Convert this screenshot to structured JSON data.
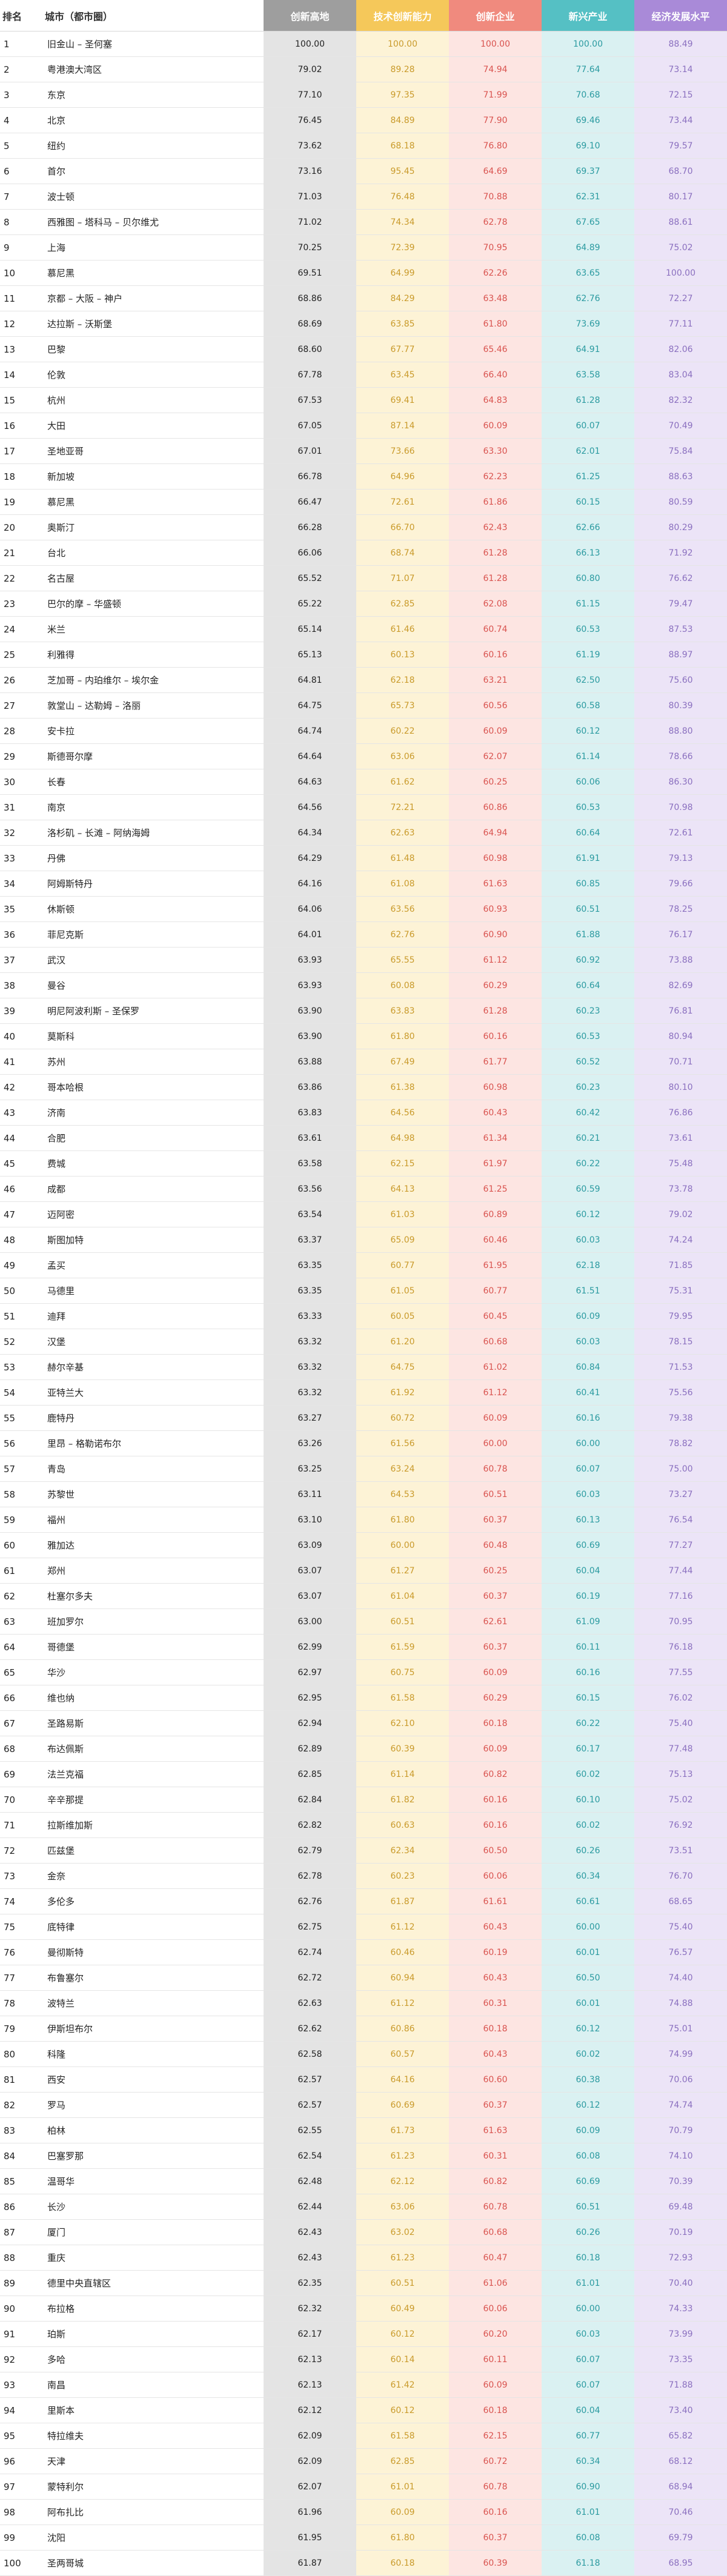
{
  "header": {
    "rank": "排名",
    "city": "城市（都市圈）",
    "metrics": [
      {
        "label": "创新高地",
        "bg": "#9e9e9e",
        "cell_bg": "#e4e4e4",
        "text": "#222222"
      },
      {
        "label": "技术创新能力",
        "bg": "#f5c85a",
        "cell_bg": "#fdf3d6",
        "text": "#c99a2a"
      },
      {
        "label": "创新企业",
        "bg": "#f08a7e",
        "cell_bg": "#fde5e2",
        "text": "#d9534f"
      },
      {
        "label": "新兴产业",
        "bg": "#55c0c4",
        "cell_bg": "#daf1f2",
        "text": "#2a9aa0"
      },
      {
        "label": "经济发展水平",
        "bg": "#a98ad8",
        "cell_bg": "#ece4f7",
        "text": "#8a6fbf"
      }
    ]
  },
  "rows": [
    {
      "rank": "1",
      "city": "旧金山 – 圣何塞",
      "values": [
        "100.00",
        "100.00",
        "100.00",
        "100.00",
        "88.49"
      ]
    },
    {
      "rank": "2",
      "city": "粤港澳大湾区",
      "values": [
        "79.02",
        "89.28",
        "74.94",
        "77.64",
        "73.14"
      ]
    },
    {
      "rank": "3",
      "city": "东京",
      "values": [
        "77.10",
        "97.35",
        "71.99",
        "70.68",
        "72.15"
      ]
    },
    {
      "rank": "4",
      "city": "北京",
      "values": [
        "76.45",
        "84.89",
        "77.90",
        "69.46",
        "73.44"
      ]
    },
    {
      "rank": "5",
      "city": "纽约",
      "values": [
        "73.62",
        "68.18",
        "76.80",
        "69.10",
        "79.57"
      ]
    },
    {
      "rank": "6",
      "city": "首尔",
      "values": [
        "73.16",
        "95.45",
        "64.69",
        "69.37",
        "68.70"
      ]
    },
    {
      "rank": "7",
      "city": "波士顿",
      "values": [
        "71.03",
        "76.48",
        "70.88",
        "62.31",
        "80.17"
      ]
    },
    {
      "rank": "8",
      "city": "西雅图 – 塔科马 – 贝尔维尤",
      "values": [
        "71.02",
        "74.34",
        "62.78",
        "67.65",
        "88.61"
      ]
    },
    {
      "rank": "9",
      "city": "上海",
      "values": [
        "70.25",
        "72.39",
        "70.95",
        "64.89",
        "75.02"
      ]
    },
    {
      "rank": "10",
      "city": "慕尼黑",
      "values": [
        "69.51",
        "64.99",
        "62.26",
        "63.65",
        "100.00"
      ]
    },
    {
      "rank": "11",
      "city": "京都 – 大阪 – 神户",
      "values": [
        "68.86",
        "84.29",
        "63.48",
        "62.76",
        "72.27"
      ]
    },
    {
      "rank": "12",
      "city": "达拉斯 – 沃斯堡",
      "values": [
        "68.69",
        "63.85",
        "61.80",
        "73.69",
        "77.11"
      ]
    },
    {
      "rank": "13",
      "city": "巴黎",
      "values": [
        "68.60",
        "67.77",
        "65.46",
        "64.91",
        "82.06"
      ]
    },
    {
      "rank": "14",
      "city": "伦敦",
      "values": [
        "67.78",
        "63.45",
        "66.40",
        "63.58",
        "83.04"
      ]
    },
    {
      "rank": "15",
      "city": "杭州",
      "values": [
        "67.53",
        "69.41",
        "64.83",
        "61.28",
        "82.32"
      ]
    },
    {
      "rank": "16",
      "city": "大田",
      "values": [
        "67.05",
        "87.14",
        "60.09",
        "60.07",
        "70.49"
      ]
    },
    {
      "rank": "17",
      "city": "圣地亚哥",
      "values": [
        "67.01",
        "73.66",
        "63.30",
        "62.01",
        "75.84"
      ]
    },
    {
      "rank": "18",
      "city": "新加坡",
      "values": [
        "66.78",
        "64.96",
        "62.23",
        "61.25",
        "88.63"
      ]
    },
    {
      "rank": "19",
      "city": "慕尼黑",
      "values": [
        "66.47",
        "72.61",
        "61.86",
        "60.15",
        "80.59"
      ]
    },
    {
      "rank": "20",
      "city": "奥斯汀",
      "values": [
        "66.28",
        "66.70",
        "62.43",
        "62.66",
        "80.29"
      ]
    },
    {
      "rank": "21",
      "city": "台北",
      "values": [
        "66.06",
        "68.74",
        "61.28",
        "66.13",
        "71.92"
      ]
    },
    {
      "rank": "22",
      "city": "名古屋",
      "values": [
        "65.52",
        "71.07",
        "61.28",
        "60.80",
        "76.62"
      ]
    },
    {
      "rank": "23",
      "city": "巴尔的摩 – 华盛顿",
      "values": [
        "65.22",
        "62.85",
        "62.08",
        "61.15",
        "79.47"
      ]
    },
    {
      "rank": "24",
      "city": "米兰",
      "values": [
        "65.14",
        "61.46",
        "60.74",
        "60.53",
        "87.53"
      ]
    },
    {
      "rank": "25",
      "city": "利雅得",
      "values": [
        "65.13",
        "60.13",
        "60.16",
        "61.19",
        "88.97"
      ]
    },
    {
      "rank": "26",
      "city": "芝加哥 – 内珀维尔 – 埃尔金",
      "values": [
        "64.81",
        "62.18",
        "63.21",
        "62.50",
        "75.60"
      ]
    },
    {
      "rank": "27",
      "city": "敦堂山 – 达勒姆 – 洛丽",
      "values": [
        "64.75",
        "65.73",
        "60.56",
        "60.58",
        "80.39"
      ]
    },
    {
      "rank": "28",
      "city": "安卡拉",
      "values": [
        "64.74",
        "60.22",
        "60.09",
        "60.12",
        "88.80"
      ]
    },
    {
      "rank": "29",
      "city": "斯德哥尔摩",
      "values": [
        "64.64",
        "63.06",
        "62.07",
        "61.14",
        "78.66"
      ]
    },
    {
      "rank": "30",
      "city": "长春",
      "values": [
        "64.63",
        "61.62",
        "60.25",
        "60.06",
        "86.30"
      ]
    },
    {
      "rank": "31",
      "city": "南京",
      "values": [
        "64.56",
        "72.21",
        "60.86",
        "60.53",
        "70.98"
      ]
    },
    {
      "rank": "32",
      "city": "洛杉矶 – 长滩 – 阿纳海姆",
      "values": [
        "64.34",
        "62.63",
        "64.94",
        "60.64",
        "72.61"
      ]
    },
    {
      "rank": "33",
      "city": "丹佛",
      "values": [
        "64.29",
        "61.48",
        "60.98",
        "61.91",
        "79.13"
      ]
    },
    {
      "rank": "34",
      "city": "阿姆斯特丹",
      "values": [
        "64.16",
        "61.08",
        "61.63",
        "60.85",
        "79.66"
      ]
    },
    {
      "rank": "35",
      "city": "休斯顿",
      "values": [
        "64.06",
        "63.56",
        "60.93",
        "60.51",
        "78.25"
      ]
    },
    {
      "rank": "36",
      "city": "菲尼克斯",
      "values": [
        "64.01",
        "62.76",
        "60.90",
        "61.88",
        "76.17"
      ]
    },
    {
      "rank": "37",
      "city": "武汉",
      "values": [
        "63.93",
        "65.55",
        "61.12",
        "60.92",
        "73.88"
      ]
    },
    {
      "rank": "38",
      "city": "曼谷",
      "values": [
        "63.93",
        "60.08",
        "60.29",
        "60.64",
        "82.69"
      ]
    },
    {
      "rank": "39",
      "city": "明尼阿波利斯 – 圣保罗",
      "values": [
        "63.90",
        "63.83",
        "61.28",
        "60.23",
        "76.81"
      ]
    },
    {
      "rank": "40",
      "city": "莫斯科",
      "values": [
        "63.90",
        "61.80",
        "60.16",
        "60.53",
        "80.94"
      ]
    },
    {
      "rank": "41",
      "city": "苏州",
      "values": [
        "63.88",
        "67.49",
        "61.77",
        "60.52",
        "70.71"
      ]
    },
    {
      "rank": "42",
      "city": "哥本哈根",
      "values": [
        "63.86",
        "61.38",
        "60.98",
        "60.23",
        "80.10"
      ]
    },
    {
      "rank": "43",
      "city": "济南",
      "values": [
        "63.83",
        "64.56",
        "60.43",
        "60.42",
        "76.86"
      ]
    },
    {
      "rank": "44",
      "city": "合肥",
      "values": [
        "63.61",
        "64.98",
        "61.34",
        "60.21",
        "73.61"
      ]
    },
    {
      "rank": "45",
      "city": "费城",
      "values": [
        "63.58",
        "62.15",
        "61.97",
        "60.22",
        "75.48"
      ]
    },
    {
      "rank": "46",
      "city": "成都",
      "values": [
        "63.56",
        "64.13",
        "61.25",
        "60.59",
        "73.78"
      ]
    },
    {
      "rank": "47",
      "city": "迈阿密",
      "values": [
        "63.54",
        "61.03",
        "60.89",
        "60.12",
        "79.02"
      ]
    },
    {
      "rank": "48",
      "city": "斯图加特",
      "values": [
        "63.37",
        "65.09",
        "60.46",
        "60.03",
        "74.24"
      ]
    },
    {
      "rank": "49",
      "city": "孟买",
      "values": [
        "63.35",
        "60.77",
        "61.95",
        "62.18",
        "71.85"
      ]
    },
    {
      "rank": "50",
      "city": "马德里",
      "values": [
        "63.35",
        "61.05",
        "60.77",
        "61.51",
        "75.31"
      ]
    },
    {
      "rank": "51",
      "city": "迪拜",
      "values": [
        "63.33",
        "60.05",
        "60.45",
        "60.09",
        "79.95"
      ]
    },
    {
      "rank": "52",
      "city": "汉堡",
      "values": [
        "63.32",
        "61.20",
        "60.68",
        "60.03",
        "78.15"
      ]
    },
    {
      "rank": "53",
      "city": "赫尔辛基",
      "values": [
        "63.32",
        "64.75",
        "61.02",
        "60.84",
        "71.53"
      ]
    },
    {
      "rank": "54",
      "city": "亚特兰大",
      "values": [
        "63.32",
        "61.92",
        "61.12",
        "60.41",
        "75.56"
      ]
    },
    {
      "rank": "55",
      "city": "鹿特丹",
      "values": [
        "63.27",
        "60.72",
        "60.09",
        "60.16",
        "79.38"
      ]
    },
    {
      "rank": "56",
      "city": "里昂 – 格勒诺布尔",
      "values": [
        "63.26",
        "61.56",
        "60.00",
        "60.00",
        "78.82"
      ]
    },
    {
      "rank": "57",
      "city": "青岛",
      "values": [
        "63.25",
        "63.24",
        "60.78",
        "60.07",
        "75.00"
      ]
    },
    {
      "rank": "58",
      "city": "苏黎世",
      "values": [
        "63.11",
        "64.53",
        "60.51",
        "60.03",
        "73.27"
      ]
    },
    {
      "rank": "59",
      "city": "福州",
      "values": [
        "63.10",
        "61.80",
        "60.37",
        "60.13",
        "76.54"
      ]
    },
    {
      "rank": "60",
      "city": "雅加达",
      "values": [
        "63.09",
        "60.00",
        "60.48",
        "60.69",
        "77.27"
      ]
    },
    {
      "rank": "61",
      "city": "郑州",
      "values": [
        "63.07",
        "61.27",
        "60.25",
        "60.04",
        "77.44"
      ]
    },
    {
      "rank": "62",
      "city": "杜塞尔多夫",
      "values": [
        "63.07",
        "61.04",
        "60.37",
        "60.19",
        "77.16"
      ]
    },
    {
      "rank": "63",
      "city": "班加罗尔",
      "values": [
        "63.00",
        "60.51",
        "62.61",
        "61.09",
        "70.95"
      ]
    },
    {
      "rank": "64",
      "city": "哥德堡",
      "values": [
        "62.99",
        "61.59",
        "60.37",
        "60.11",
        "76.18"
      ]
    },
    {
      "rank": "65",
      "city": "华沙",
      "values": [
        "62.97",
        "60.75",
        "60.09",
        "60.16",
        "77.55"
      ]
    },
    {
      "rank": "66",
      "city": "维也纳",
      "values": [
        "62.95",
        "61.58",
        "60.29",
        "60.15",
        "76.02"
      ]
    },
    {
      "rank": "67",
      "city": "圣路易斯",
      "values": [
        "62.94",
        "62.10",
        "60.18",
        "60.22",
        "75.40"
      ]
    },
    {
      "rank": "68",
      "city": "布达佩斯",
      "values": [
        "62.89",
        "60.39",
        "60.09",
        "60.17",
        "77.48"
      ]
    },
    {
      "rank": "69",
      "city": "法兰克福",
      "values": [
        "62.85",
        "61.14",
        "60.82",
        "60.02",
        "75.13"
      ]
    },
    {
      "rank": "70",
      "city": "辛辛那提",
      "values": [
        "62.84",
        "61.82",
        "60.16",
        "60.10",
        "75.02"
      ]
    },
    {
      "rank": "71",
      "city": "拉斯维加斯",
      "values": [
        "62.82",
        "60.63",
        "60.16",
        "60.02",
        "76.92"
      ]
    },
    {
      "rank": "72",
      "city": "匹兹堡",
      "values": [
        "62.79",
        "62.34",
        "60.50",
        "60.26",
        "73.51"
      ]
    },
    {
      "rank": "73",
      "city": "金奈",
      "values": [
        "62.78",
        "60.23",
        "60.06",
        "60.34",
        "76.70"
      ]
    },
    {
      "rank": "74",
      "city": "多伦多",
      "values": [
        "62.76",
        "61.87",
        "61.61",
        "60.61",
        "68.65"
      ]
    },
    {
      "rank": "75",
      "city": "底特律",
      "values": [
        "62.75",
        "61.12",
        "60.43",
        "60.00",
        "75.40"
      ]
    },
    {
      "rank": "76",
      "city": "曼彻斯特",
      "values": [
        "62.74",
        "60.46",
        "60.19",
        "60.01",
        "76.57"
      ]
    },
    {
      "rank": "77",
      "city": "布鲁塞尔",
      "values": [
        "62.72",
        "60.94",
        "60.43",
        "60.50",
        "74.40"
      ]
    },
    {
      "rank": "78",
      "city": "波特兰",
      "values": [
        "62.63",
        "61.12",
        "60.31",
        "60.01",
        "74.88"
      ]
    },
    {
      "rank": "79",
      "city": "伊斯坦布尔",
      "values": [
        "62.62",
        "60.86",
        "60.18",
        "60.12",
        "75.01"
      ]
    },
    {
      "rank": "80",
      "city": "科隆",
      "values": [
        "62.58",
        "60.57",
        "60.43",
        "60.02",
        "74.99"
      ]
    },
    {
      "rank": "81",
      "city": "西安",
      "values": [
        "62.57",
        "64.16",
        "60.60",
        "60.38",
        "70.06"
      ]
    },
    {
      "rank": "82",
      "city": "罗马",
      "values": [
        "62.57",
        "60.69",
        "60.37",
        "60.12",
        "74.74"
      ]
    },
    {
      "rank": "83",
      "city": "柏林",
      "values": [
        "62.55",
        "61.73",
        "61.63",
        "60.09",
        "70.79"
      ]
    },
    {
      "rank": "84",
      "city": "巴塞罗那",
      "values": [
        "62.54",
        "61.23",
        "60.31",
        "60.08",
        "74.10"
      ]
    },
    {
      "rank": "85",
      "city": "温哥华",
      "values": [
        "62.48",
        "62.12",
        "60.82",
        "60.69",
        "70.39"
      ]
    },
    {
      "rank": "86",
      "city": "长沙",
      "values": [
        "62.44",
        "63.06",
        "60.78",
        "60.51",
        "69.48"
      ]
    },
    {
      "rank": "87",
      "city": "厦门",
      "values": [
        "62.43",
        "63.02",
        "60.68",
        "60.26",
        "70.19"
      ]
    },
    {
      "rank": "88",
      "city": "重庆",
      "values": [
        "62.43",
        "61.23",
        "60.47",
        "60.18",
        "72.93"
      ]
    },
    {
      "rank": "89",
      "city": "德里中央直辖区",
      "values": [
        "62.35",
        "60.51",
        "61.06",
        "61.01",
        "70.40"
      ]
    },
    {
      "rank": "90",
      "city": "布拉格",
      "values": [
        "62.32",
        "60.49",
        "60.06",
        "60.00",
        "74.33"
      ]
    },
    {
      "rank": "91",
      "city": "珀斯",
      "values": [
        "62.17",
        "60.12",
        "60.20",
        "60.03",
        "73.99"
      ]
    },
    {
      "rank": "92",
      "city": "多哈",
      "values": [
        "62.13",
        "60.14",
        "60.11",
        "60.07",
        "73.35"
      ]
    },
    {
      "rank": "93",
      "city": "南昌",
      "values": [
        "62.13",
        "61.42",
        "60.09",
        "60.07",
        "71.88"
      ]
    },
    {
      "rank": "94",
      "city": "里斯本",
      "values": [
        "62.12",
        "60.12",
        "60.18",
        "60.04",
        "73.40"
      ]
    },
    {
      "rank": "95",
      "city": "特拉维夫",
      "values": [
        "62.09",
        "61.58",
        "62.15",
        "60.77",
        "65.82"
      ]
    },
    {
      "rank": "96",
      "city": "天津",
      "values": [
        "62.09",
        "62.85",
        "60.72",
        "60.34",
        "68.12"
      ]
    },
    {
      "rank": "97",
      "city": "蒙特利尔",
      "values": [
        "62.07",
        "61.01",
        "60.78",
        "60.90",
        "68.94"
      ]
    },
    {
      "rank": "98",
      "city": "阿布扎比",
      "values": [
        "61.96",
        "60.09",
        "60.16",
        "61.01",
        "70.46"
      ]
    },
    {
      "rank": "99",
      "city": "沈阳",
      "values": [
        "61.95",
        "61.80",
        "60.37",
        "60.08",
        "69.79"
      ]
    },
    {
      "rank": "100",
      "city": "圣两哥城",
      "values": [
        "61.87",
        "60.18",
        "60.39",
        "61.18",
        "68.95"
      ]
    }
  ]
}
